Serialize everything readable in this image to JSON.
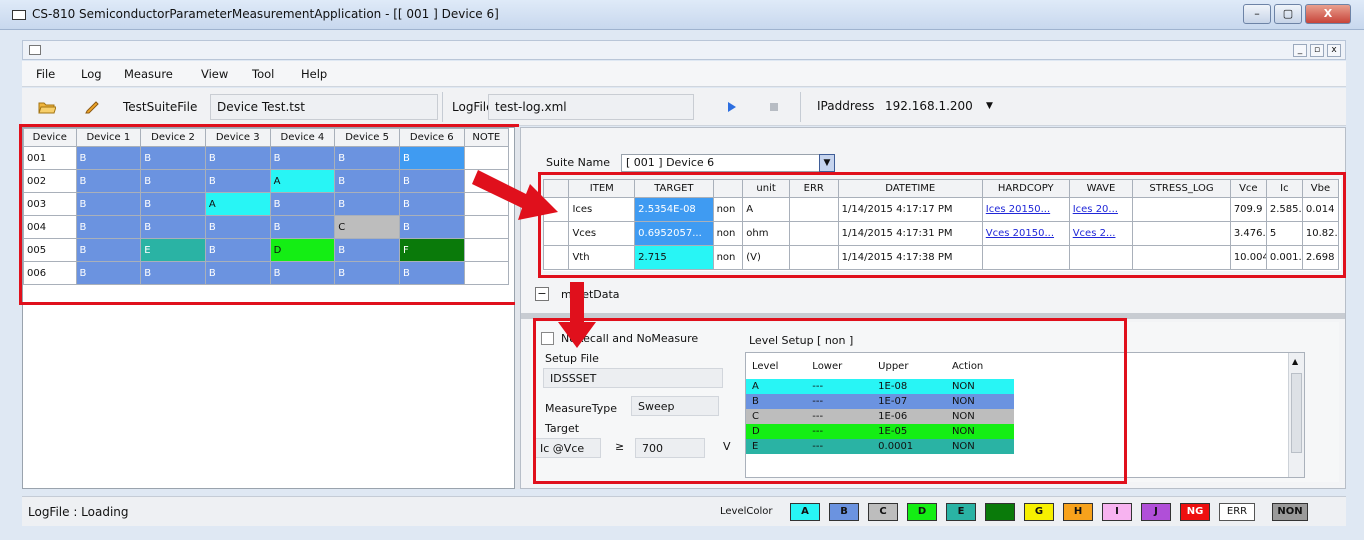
{
  "window": {
    "title": "CS-810 SemiconductorParameterMeasurementApplication - [[ 001 ] Device 6]"
  },
  "window_controls": [
    "–",
    "▢",
    "X"
  ],
  "mdi_controls": [
    "_",
    "▫",
    "x"
  ],
  "menu": [
    "File",
    "Log",
    "Measure",
    "View",
    "Tool",
    "Help"
  ],
  "toolbar": {
    "testsuite_label": "TestSuiteFile",
    "testsuite_value": "Device Test.tst",
    "logfile_label": "LogFile",
    "logfile_value": "test-log.xml",
    "ip_label": "IPaddress",
    "ip_value": "192.168.1.200"
  },
  "device_grid": {
    "headers": [
      "Device",
      "Device 1",
      "Device 2",
      "Device 3",
      "Device 4",
      "Device 5",
      "Device 6",
      "NOTE"
    ],
    "rows": [
      {
        "id": "001",
        "cells": [
          [
            "B",
            "blue"
          ],
          [
            "B",
            "blue"
          ],
          [
            "B",
            "blue"
          ],
          [
            "B",
            "blue"
          ],
          [
            "B",
            "blue"
          ],
          [
            "B",
            "lightblue"
          ]
        ]
      },
      {
        "id": "002",
        "cells": [
          [
            "B",
            "blue"
          ],
          [
            "B",
            "blue"
          ],
          [
            "B",
            "blue"
          ],
          [
            "A",
            "cyan"
          ],
          [
            "B",
            "blue"
          ],
          [
            "B",
            "blue"
          ]
        ]
      },
      {
        "id": "003",
        "cells": [
          [
            "B",
            "blue"
          ],
          [
            "B",
            "blue"
          ],
          [
            "A",
            "cyan"
          ],
          [
            "B",
            "blue"
          ],
          [
            "B",
            "blue"
          ],
          [
            "B",
            "blue"
          ]
        ]
      },
      {
        "id": "004",
        "cells": [
          [
            "B",
            "blue"
          ],
          [
            "B",
            "blue"
          ],
          [
            "B",
            "blue"
          ],
          [
            "B",
            "blue"
          ],
          [
            "C",
            "gray"
          ],
          [
            "B",
            "blue"
          ]
        ]
      },
      {
        "id": "005",
        "cells": [
          [
            "B",
            "blue"
          ],
          [
            "E",
            "teal"
          ],
          [
            "B",
            "blue"
          ],
          [
            "D",
            "green"
          ],
          [
            "B",
            "blue"
          ],
          [
            "F",
            "dkgreen"
          ]
        ]
      },
      {
        "id": "006",
        "cells": [
          [
            "B",
            "blue"
          ],
          [
            "B",
            "blue"
          ],
          [
            "B",
            "blue"
          ],
          [
            "B",
            "blue"
          ],
          [
            "B",
            "blue"
          ],
          [
            "B",
            "blue"
          ]
        ]
      }
    ]
  },
  "suite": {
    "label": "Suite Name",
    "value": "[ 001 ] Device 6"
  },
  "results": {
    "headers": [
      "",
      "ITEM",
      "TARGET",
      "",
      "unit",
      "ERR",
      "DATETIME",
      "HARDCOPY",
      "WAVE",
      "STRESS_LOG",
      "Vce",
      "Ic",
      "Vbe"
    ],
    "rows": [
      {
        "item": "Ices",
        "target": "2.5354E-08",
        "mode": "non",
        "unit": "A",
        "err": "",
        "datetime": "1/14/2015 4:17:17 PM",
        "hardcopy": "Ices 20150...",
        "wave": "Ices 20...",
        "stress": "",
        "vce": "709.9",
        "ic": "2.585...",
        "vbe": "0.014"
      },
      {
        "item": "Vces",
        "target": "0.6952057...",
        "mode": "non",
        "unit": "ohm",
        "err": "",
        "datetime": "1/14/2015 4:17:31 PM",
        "hardcopy": "Vces 20150...",
        "wave": "Vces 2...",
        "stress": "",
        "vce": "3.476...",
        "ic": "5",
        "vbe": "10.82..."
      },
      {
        "item": "Vth",
        "target": "2.715",
        "mode": "non",
        "unit": "(V)",
        "err": "",
        "datetime": "1/14/2015 4:17:38 PM",
        "hardcopy": "",
        "wave": "",
        "stress": "",
        "vce": "10.004",
        "ic": "0.001...",
        "vbe": "2.698"
      }
    ]
  },
  "setdata": {
    "label": "m SetData",
    "toggle": "−"
  },
  "setup": {
    "recall_label": "NoRecall and NoMeasure",
    "setup_file_label": "Setup File",
    "setup_file_value": "IDSSSET",
    "measure_type_label": "MeasureType",
    "measure_type_value": "Sweep",
    "target_label": "Target",
    "ic_label": "Ic",
    "vce_label": "@Vce",
    "cmp": "≥",
    "target_value": "700",
    "unit": "V"
  },
  "level_setup": {
    "label": "Level Setup [ non ]",
    "headers": [
      "Level",
      "Lower",
      "Upper",
      "Action"
    ],
    "rows": [
      {
        "level": "A",
        "lower": "---",
        "upper": "1E-08",
        "action": "NON",
        "color": "#28f5f5"
      },
      {
        "level": "B",
        "lower": "---",
        "upper": "1E-07",
        "action": "NON",
        "color": "#6b93e0"
      },
      {
        "level": "C",
        "lower": "---",
        "upper": "1E-06",
        "action": "NON",
        "color": "#bdbdbd"
      },
      {
        "level": "D",
        "lower": "---",
        "upper": "1E-05",
        "action": "NON",
        "color": "#14ee14"
      },
      {
        "level": "E",
        "lower": "---",
        "upper": "0.0001",
        "action": "NON",
        "color": "#2ab3a4"
      }
    ]
  },
  "status": {
    "text": "LogFile : Loading",
    "levelcolor_label": "LevelColor"
  },
  "level_colors": [
    {
      "label": "A",
      "color": "#28f5f5"
    },
    {
      "label": "B",
      "color": "#6b93e0"
    },
    {
      "label": "C",
      "color": "#bdbdbd"
    },
    {
      "label": "D",
      "color": "#14ee14"
    },
    {
      "label": "E",
      "color": "#2ab3a4"
    },
    {
      "label": "F",
      "color": "#0a7a0a"
    },
    {
      "label": "G",
      "color": "#f7f000"
    },
    {
      "label": "H",
      "color": "#f7a21c"
    },
    {
      "label": "I",
      "color": "#f7b3f0"
    },
    {
      "label": "J",
      "color": "#b04fd8"
    },
    {
      "label": "NG",
      "color": "#ee0f0f"
    },
    {
      "label": "ERR",
      "color": "#ffffff"
    },
    {
      "label": "NON",
      "color": "#9a9a9a"
    }
  ]
}
